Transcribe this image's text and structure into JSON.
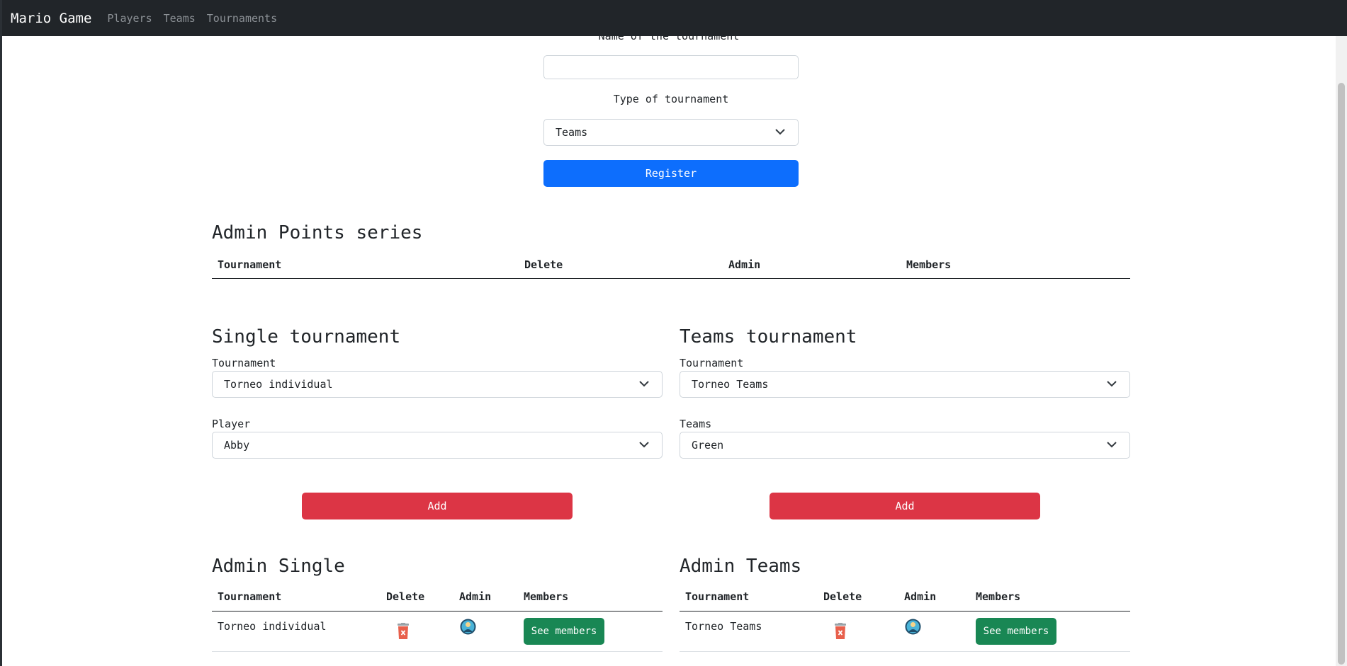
{
  "navbar": {
    "brand": "Mario Game",
    "links": [
      "Players",
      "Teams",
      "Tournaments"
    ]
  },
  "register_form": {
    "name_label": "Name of the tournament",
    "name_value": "",
    "type_label": "Type of tournament",
    "type_selected": "Teams",
    "register_button": "Register"
  },
  "admin_points": {
    "title": "Admin Points series",
    "columns": [
      "Tournament",
      "Delete",
      "Admin",
      "Members"
    ]
  },
  "single_tournament": {
    "title": "Single tournament",
    "tournament_label": "Tournament",
    "tournament_selected": "Torneo individual",
    "player_label": "Player",
    "player_selected": "Abby",
    "add_button": "Add"
  },
  "teams_tournament": {
    "title": "Teams tournament",
    "tournament_label": "Tournament",
    "tournament_selected": "Torneo Teams",
    "teams_label": "Teams",
    "teams_selected": "Green",
    "add_button": "Add"
  },
  "admin_single": {
    "title": "Admin Single",
    "columns": [
      "Tournament",
      "Delete",
      "Admin",
      "Members"
    ],
    "rows": [
      {
        "tournament": "Torneo individual",
        "members_button": "See members"
      }
    ]
  },
  "admin_teams": {
    "title": "Admin Teams",
    "columns": [
      "Tournament",
      "Delete",
      "Admin",
      "Members"
    ],
    "rows": [
      {
        "tournament": "Torneo Teams",
        "members_button": "See members"
      }
    ]
  },
  "icons": {
    "delete": "trash-icon",
    "admin": "admin-avatar-icon",
    "select": "chevron-down-icon"
  },
  "colors": {
    "navbar": "#212529",
    "primary": "#0d6efd",
    "danger": "#dc3545",
    "success": "#198754"
  }
}
